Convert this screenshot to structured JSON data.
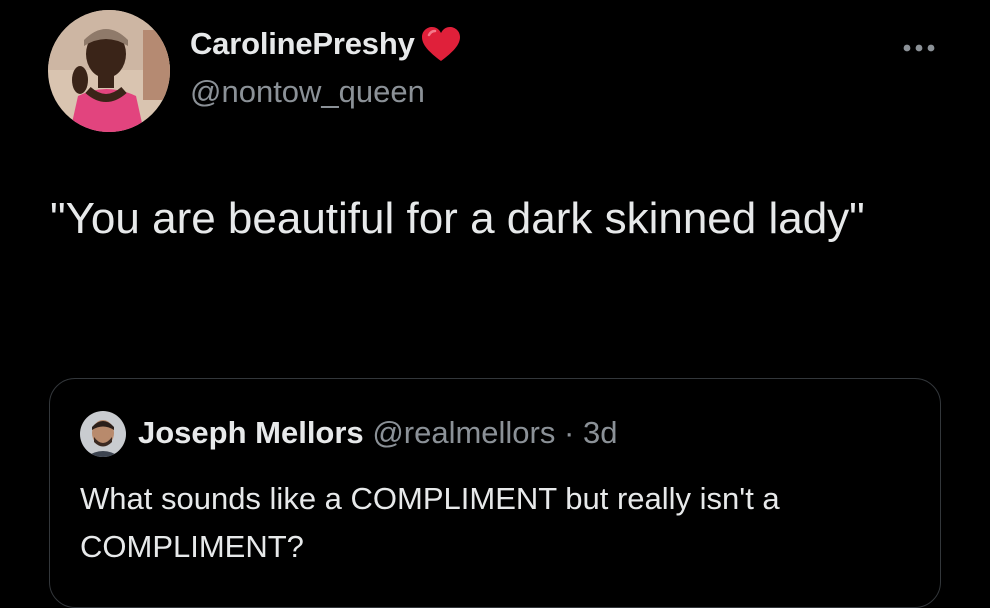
{
  "tweet": {
    "author": {
      "display_name": "CarolinePreshy",
      "handle": "@nontow_queen",
      "badge_icon": "red-heart-icon"
    },
    "text": "\"You are beautiful for a dark skinned lady\"",
    "more_icon": "more-horizontal-icon"
  },
  "quoted_tweet": {
    "author": {
      "display_name": "Joseph Mellors",
      "handle": "@realmellors",
      "separator": "·",
      "time": "3d"
    },
    "text": "What sounds like a COMPLIMENT but really isn't a COMPLIMENT?"
  },
  "colors": {
    "background": "#000000",
    "primary_text": "#e7e9ea",
    "secondary_text": "#8b9197",
    "border": "#33373b",
    "heart": "#e0203a"
  }
}
